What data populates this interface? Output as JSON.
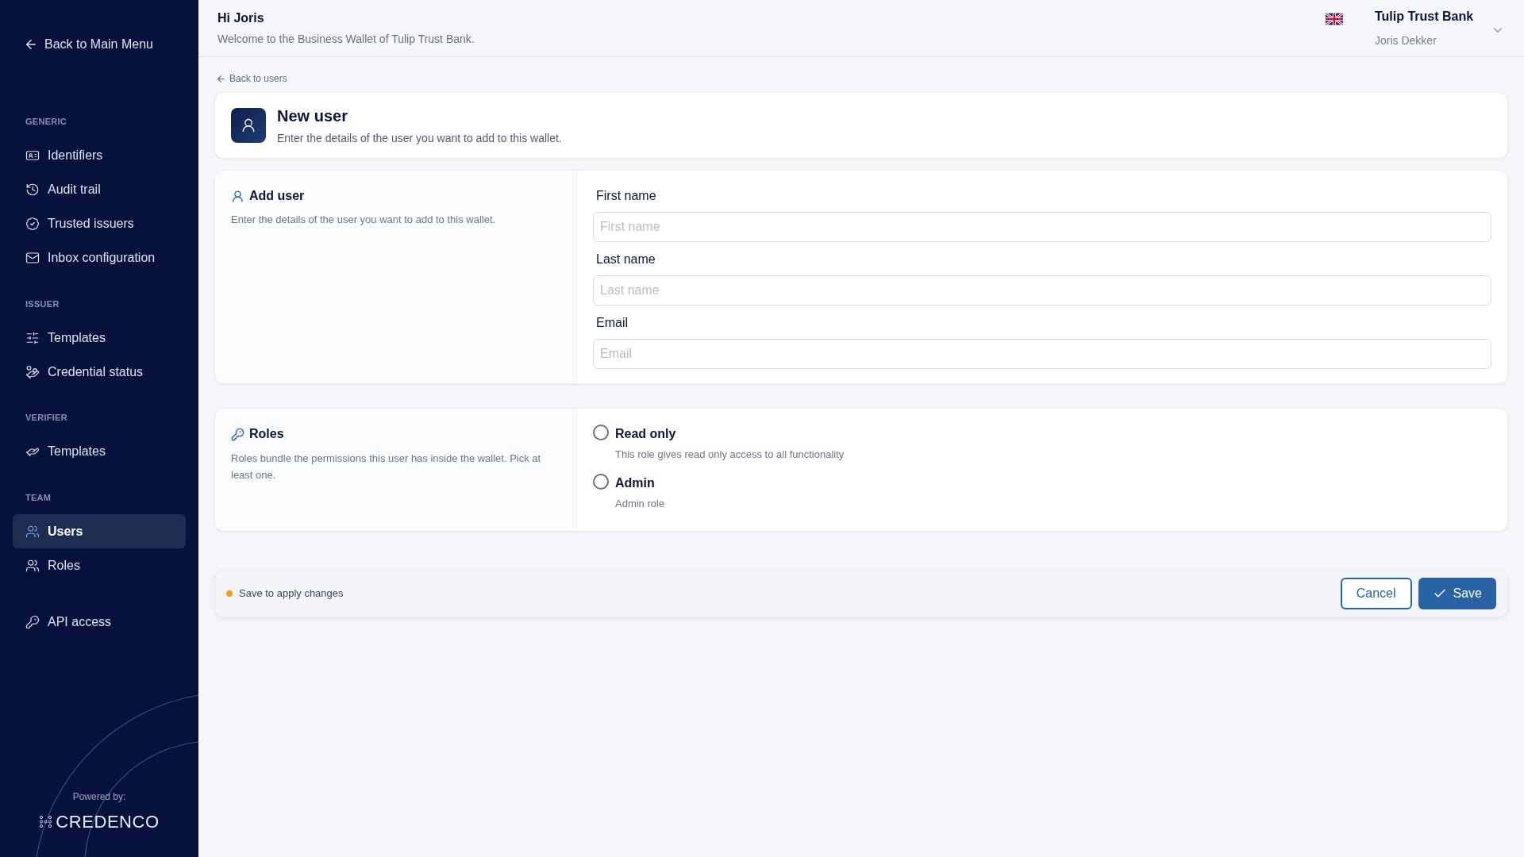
{
  "sidebar": {
    "back_link": "Back to Main Menu",
    "sections": [
      {
        "label": "GENERIC",
        "items": [
          {
            "label": "Identifiers",
            "selected": false
          },
          {
            "label": "Audit trail",
            "selected": false
          },
          {
            "label": "Trusted issuers",
            "selected": false
          },
          {
            "label": "Inbox configuration",
            "selected": false
          }
        ]
      },
      {
        "label": "ISSUER",
        "items": [
          {
            "label": "Templates",
            "selected": false
          },
          {
            "label": "Credential status",
            "selected": false
          }
        ]
      },
      {
        "label": "VERIFIER",
        "items": [
          {
            "label": "Templates",
            "selected": false
          }
        ]
      },
      {
        "label": "TEAM",
        "items": [
          {
            "label": "Users",
            "selected": true
          },
          {
            "label": "Roles",
            "selected": false
          }
        ]
      },
      {
        "items": [
          {
            "label": "API access",
            "selected": false
          }
        ]
      }
    ],
    "powered_by": "Powered by:",
    "brand": "CREDENCO"
  },
  "header": {
    "greeting": "Hi Joris",
    "welcome": "Welcome to the Business Wallet of Tulip Trust Bank.",
    "organization": "Tulip Trust Bank",
    "user": "Joris Dekker"
  },
  "back_link": "Back to users",
  "page": {
    "title": "New user",
    "subtitle": "Enter the details of the user you want to add to this wallet."
  },
  "user_section": {
    "title": "Add user",
    "description": "Enter the details of the user you want to add to this wallet.",
    "fields": [
      {
        "label": "First name",
        "placeholder": "First name"
      },
      {
        "label": "Last name",
        "placeholder": "Last name"
      },
      {
        "label": "Email",
        "placeholder": "Email"
      }
    ]
  },
  "roles_section": {
    "title": "Roles",
    "description": "Roles bundle the permissions this user has inside the wallet. Pick at least one.",
    "roles": [
      {
        "name": "Read only",
        "description": "This role gives read only access to all functionality",
        "checked": false
      },
      {
        "name": "Admin",
        "description": "Admin role",
        "checked": false
      }
    ]
  },
  "footer": {
    "status": "Save to apply changes",
    "buttons": [
      {
        "label": "Cancel",
        "kind": "secondary"
      },
      {
        "label": "Save",
        "kind": "primary"
      }
    ]
  }
}
